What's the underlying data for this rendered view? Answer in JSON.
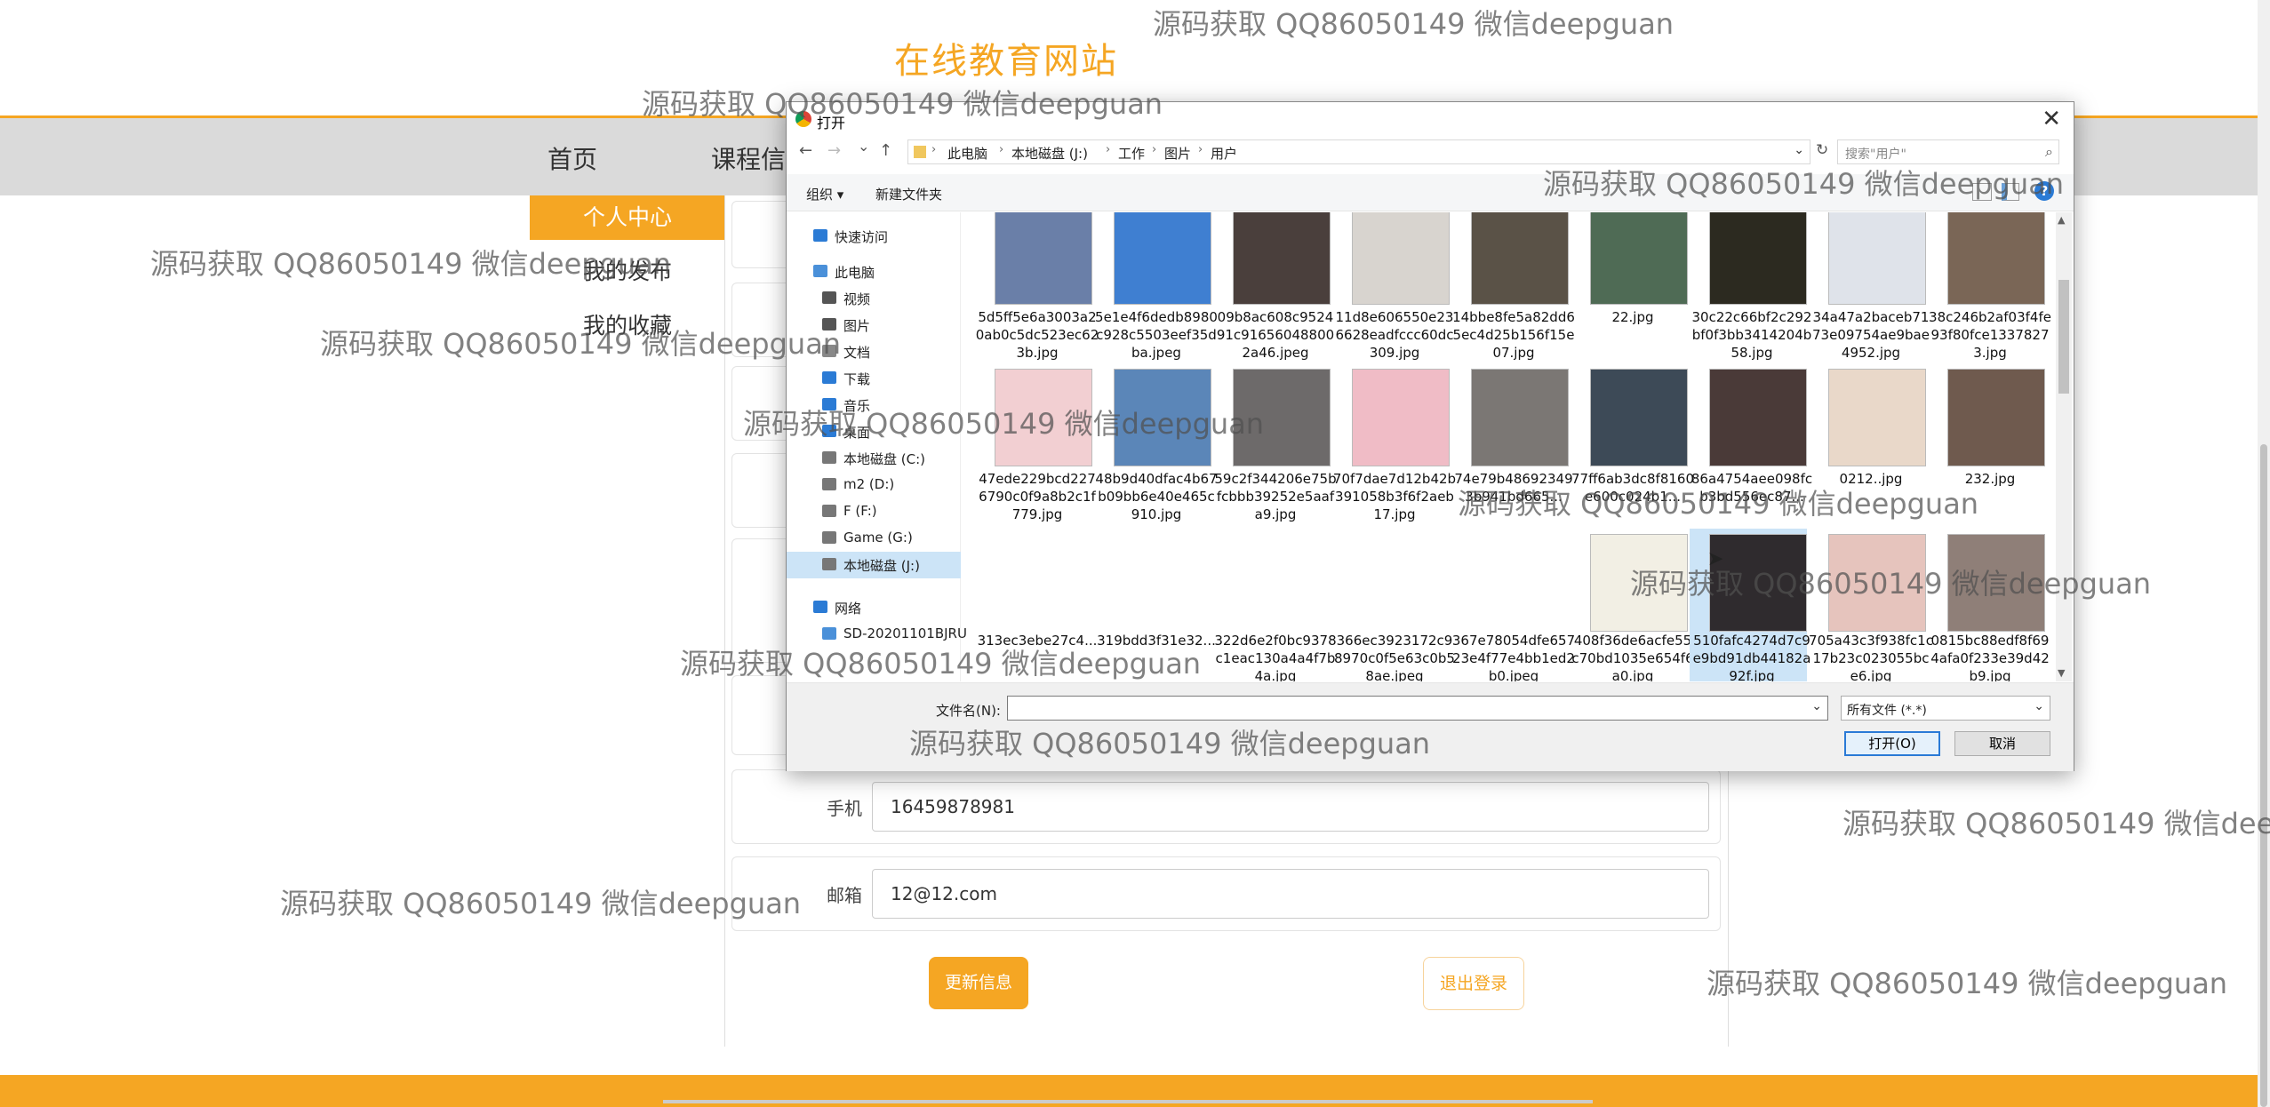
{
  "site": {
    "title": "在线教育网站",
    "nav": [
      "首页",
      "课程信"
    ]
  },
  "side_menu": {
    "active": "个人中心",
    "items": [
      "我的发布",
      "我的收藏"
    ]
  },
  "form": {
    "phone": {
      "label": "手机",
      "value": "16459878981"
    },
    "email": {
      "label": "邮箱",
      "value": "12@12.com"
    },
    "update_button": "更新信息",
    "logout_button": "退出登录"
  },
  "dialog": {
    "title": "打开",
    "close": "✕",
    "nav_back": "←",
    "nav_forward": "→",
    "nav_recent": "⌄",
    "nav_up": "↑",
    "breadcrumb": [
      "此电脑",
      "本地磁盘 (J:)",
      "工作",
      "图片",
      "用户"
    ],
    "refresh": "↻",
    "search_placeholder": "搜索\"用户\"",
    "search_icon": "⌕",
    "toolbar": {
      "organize": "组织 ▾",
      "new_folder": "新建文件夹",
      "help": "?"
    },
    "tree": [
      {
        "label": "快速访问",
        "icon": "star-icon",
        "color": "#2b7bd5",
        "level": 1
      },
      {
        "label": "此电脑",
        "icon": "computer-icon",
        "color": "#4a90d9",
        "level": 1
      },
      {
        "label": "视频",
        "icon": "video-icon",
        "color": "#555555",
        "level": 2
      },
      {
        "label": "图片",
        "icon": "picture-icon",
        "color": "#555555",
        "level": 2
      },
      {
        "label": "文档",
        "icon": "document-icon",
        "color": "#888888",
        "level": 2
      },
      {
        "label": "下载",
        "icon": "download-icon",
        "color": "#2b7bd5",
        "level": 2
      },
      {
        "label": "音乐",
        "icon": "music-icon",
        "color": "#2b7bd5",
        "level": 2
      },
      {
        "label": "桌面",
        "icon": "desktop-icon",
        "color": "#2b7bd5",
        "level": 2
      },
      {
        "label": "本地磁盘 (C:)",
        "icon": "drive-icon",
        "color": "#777777",
        "level": 2
      },
      {
        "label": "m2 (D:)",
        "icon": "drive-icon",
        "color": "#777777",
        "level": 2
      },
      {
        "label": "F (F:)",
        "icon": "drive-icon",
        "color": "#777777",
        "level": 2
      },
      {
        "label": "Game (G:)",
        "icon": "drive-icon",
        "color": "#777777",
        "level": 2
      },
      {
        "label": "本地磁盘 (J:)",
        "icon": "drive-icon",
        "color": "#777777",
        "level": 2,
        "selected": true
      },
      {
        "label": "网络",
        "icon": "network-icon",
        "color": "#2b7bd5",
        "level": 1
      },
      {
        "label": "SD-20201101BJRU",
        "icon": "computer-icon",
        "color": "#4a90d9",
        "level": 2
      }
    ],
    "files": [
      {
        "name": "5d5ff5e6a3003a20ab0c5dc523ec623b.jpg",
        "color": "#6a7fa8"
      },
      {
        "name": "5e1e4f6dedb8980c928c5503eef35dba.jpeg",
        "color": "#3f7fd1"
      },
      {
        "name": "09b8ac608c952491c916560488002a46.jpeg",
        "color": "#4a3f3c"
      },
      {
        "name": "11d8e606550e236628eadfccc60dc309.jpg",
        "color": "#d8d4cf"
      },
      {
        "name": "14bbe8fe5a82dd65ec4d25b156f15e07.jpg",
        "color": "#5a5247"
      },
      {
        "name": "22.jpg",
        "color": "#4f6b55"
      },
      {
        "name": "30c22c66bf2c292bf0f3bb3414204b58.jpg",
        "color": "#2c2a20"
      },
      {
        "name": "34a47a2baceb7173e09754ae9bae4952.jpg",
        "color": "#dfe3ea"
      },
      {
        "name": "38c246b2af03f4fe93f80fce13378273.jpg",
        "color": "#7a6656"
      },
      {
        "name": "47ede229bcd2276790c0f9a8b2c1f779.jpg",
        "color": "#f2cfd2"
      },
      {
        "name": "48b9d40dfac4b67b09bb6e40e465c910.jpg",
        "color": "#5b86b8"
      },
      {
        "name": "59c2f344206e75bfcbbb39252e5aafa9.jpg",
        "color": "#6d6a6a"
      },
      {
        "name": "70f7dae7d12b42b391058b3f6f2aeb17.jpg",
        "color": "#f0bcc6"
      },
      {
        "name": "74e79b486923493b941bd665...",
        "color": "#7b7774"
      },
      {
        "name": "77ff6ab3dc8f8160e600c024b1...",
        "color": "#3d4a57"
      },
      {
        "name": "86a4754aee098fcb3bd556ec87...",
        "color": "#4a3a38"
      },
      {
        "name": "0212..jpg",
        "color": "#e9d8c9"
      },
      {
        "name": "232.jpg",
        "color": "#6f5a4e"
      },
      {
        "name": "313ec3ebe27c4...",
        "color": "",
        "empty": true
      },
      {
        "name": "319bdd3f31e32...",
        "color": "",
        "empty": true
      },
      {
        "name": "322d6e2f0bc9378c1eac130a4a4f7b4a.jpg",
        "color": "",
        "empty": true
      },
      {
        "name": "366ec3923172c98970c0f5e63c0b58ae.jpeg",
        "color": "",
        "empty": true
      },
      {
        "name": "367e78054dfe65723e4f77e4bb1ed2b0.jpeg",
        "color": "",
        "empty": true
      },
      {
        "name": "408f36de6acfe55c70bd1035e654f6a0.jpg",
        "color": "#f2efe4"
      },
      {
        "name": "510fafc4274d7c9e9bd91db44182a92f.jpg",
        "color": "#2f2b2e",
        "selected": true
      },
      {
        "name": "705a43c3f938fc1c17b23c023055bce6.jpg",
        "color": "#e6c4bd"
      },
      {
        "name": "0815bc88edf8f694afa0f233e39d42b9.jpg",
        "color": "#8f7f78"
      }
    ],
    "filename_label": "文件名(N):",
    "filename_value": "",
    "filetype": "所有文件 (*.*)",
    "open_button": "打开(O)",
    "cancel_button": "取消"
  },
  "watermark": "源码获取 QQ86050149 微信deepguan"
}
